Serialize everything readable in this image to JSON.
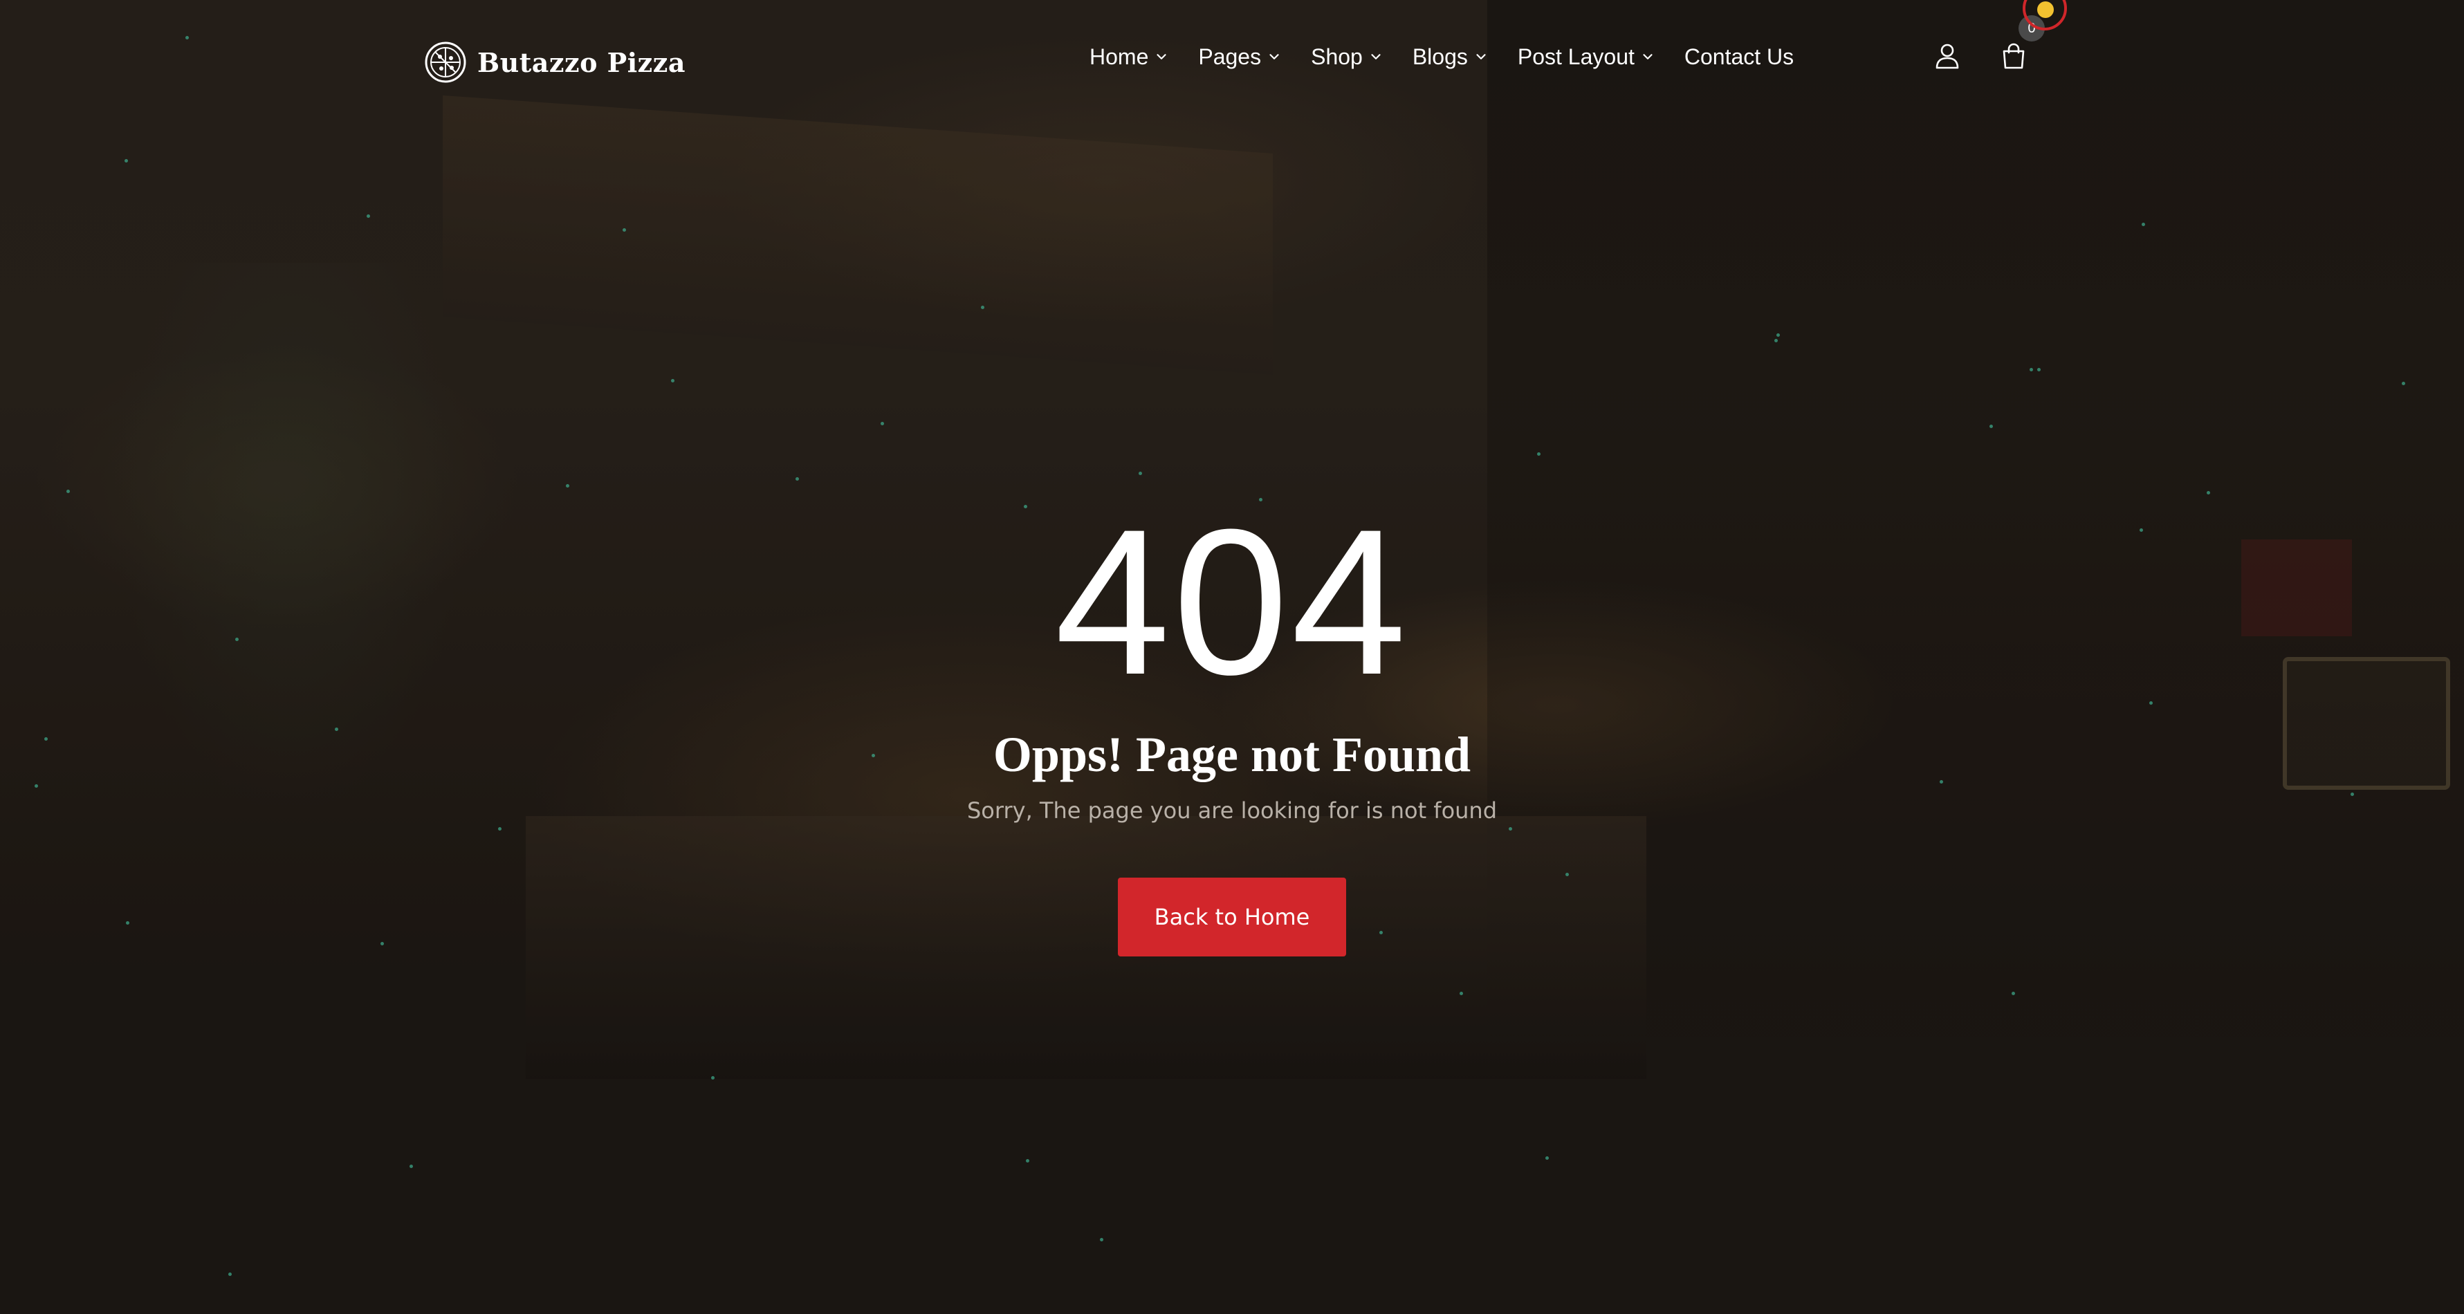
{
  "brand": {
    "name": "Butazzo Pizza",
    "logo_icon": "pizza-icon"
  },
  "nav": {
    "items": [
      {
        "label": "Home",
        "has_dropdown": true
      },
      {
        "label": "Pages",
        "has_dropdown": true
      },
      {
        "label": "Shop",
        "has_dropdown": true
      },
      {
        "label": "Blogs",
        "has_dropdown": true
      },
      {
        "label": "Post Layout",
        "has_dropdown": true
      },
      {
        "label": "Contact Us",
        "has_dropdown": false
      }
    ],
    "dropdown_icon": "chevron-down-icon"
  },
  "header_icons": {
    "account_icon": "user-icon",
    "cart_icon": "shopping-bag-icon",
    "cart_count": "0"
  },
  "error": {
    "code": "404",
    "title": "Opps! Page not Found",
    "message": "Sorry, The page you are looking for is not found",
    "button_label": "Back to Home"
  },
  "colors": {
    "accent": "#d2262b",
    "text": "#ffffff",
    "muted_text": "#b9b1a8",
    "particle": "#3fae8e"
  }
}
